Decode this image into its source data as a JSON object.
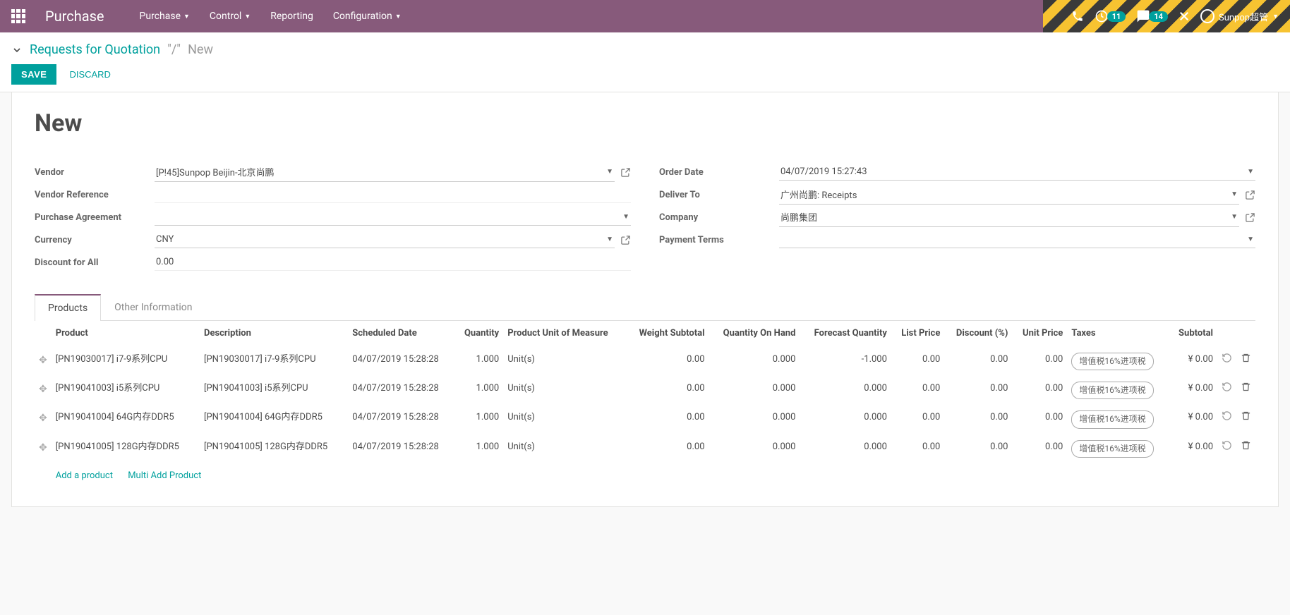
{
  "nav": {
    "brand": "Purchase",
    "items": [
      "Purchase",
      "Control",
      "Reporting",
      "Configuration"
    ],
    "badge1": "11",
    "badge2": "14",
    "user": "Sunpop超管"
  },
  "breadcrumb": {
    "parent": "Requests for Quotation",
    "sep": "\"/\"",
    "active": "New"
  },
  "buttons": {
    "save": "SAVE",
    "discard": "DISCARD"
  },
  "form": {
    "title": "New",
    "labels": {
      "vendor": "Vendor",
      "vendor_ref": "Vendor Reference",
      "purchase_agreement": "Purchase Agreement",
      "currency": "Currency",
      "discount_all": "Discount for All",
      "order_date": "Order Date",
      "deliver_to": "Deliver To",
      "company": "Company",
      "payment_terms": "Payment Terms"
    },
    "values": {
      "vendor": "[P!45]Sunpop Beijin-北京尚鹏",
      "vendor_ref": "",
      "purchase_agreement": "",
      "currency": "CNY",
      "discount_all": "0.00",
      "order_date": "04/07/2019 15:27:43",
      "deliver_to": "广州尚鹏: Receipts",
      "company": "尚鹏集团",
      "payment_terms": ""
    }
  },
  "tabs": {
    "products": "Products",
    "other": "Other Information"
  },
  "table": {
    "headers": {
      "product": "Product",
      "description": "Description",
      "scheduled_date": "Scheduled Date",
      "quantity": "Quantity",
      "uom": "Product Unit of Measure",
      "weight_subtotal": "Weight Subtotal",
      "qty_on_hand": "Quantity On Hand",
      "forecast_qty": "Forecast Quantity",
      "list_price": "List Price",
      "discount": "Discount (%)",
      "unit_price": "Unit Price",
      "taxes": "Taxes",
      "subtotal": "Subtotal"
    },
    "rows": [
      {
        "product": "[PN19030017] i7-9系列CPU",
        "description": "[PN19030017] i7-9系列CPU",
        "date": "04/07/2019 15:28:28",
        "qty": "1.000",
        "uom": "Unit(s)",
        "ws": "0.00",
        "qoh": "0.000",
        "fq": "-1.000",
        "lp": "0.00",
        "disc": "0.00",
        "up": "0.00",
        "tax": "增值税16%进项税",
        "sub": "¥ 0.00"
      },
      {
        "product": "[PN19041003] i5系列CPU",
        "description": "[PN19041003] i5系列CPU",
        "date": "04/07/2019 15:28:28",
        "qty": "1.000",
        "uom": "Unit(s)",
        "ws": "0.00",
        "qoh": "0.000",
        "fq": "0.000",
        "lp": "0.00",
        "disc": "0.00",
        "up": "0.00",
        "tax": "增值税16%进项税",
        "sub": "¥ 0.00"
      },
      {
        "product": "[PN19041004] 64G内存DDR5",
        "description": "[PN19041004] 64G内存DDR5",
        "date": "04/07/2019 15:28:28",
        "qty": "1.000",
        "uom": "Unit(s)",
        "ws": "0.00",
        "qoh": "0.000",
        "fq": "0.000",
        "lp": "0.00",
        "disc": "0.00",
        "up": "0.00",
        "tax": "增值税16%进项税",
        "sub": "¥ 0.00"
      },
      {
        "product": "[PN19041005] 128G内存DDR5",
        "description": "[PN19041005] 128G内存DDR5",
        "date": "04/07/2019 15:28:28",
        "qty": "1.000",
        "uom": "Unit(s)",
        "ws": "0.00",
        "qoh": "0.000",
        "fq": "0.000",
        "lp": "0.00",
        "disc": "0.00",
        "up": "0.00",
        "tax": "增值税16%进项税",
        "sub": "¥ 0.00"
      }
    ],
    "footer": {
      "add_product": "Add a product",
      "multi_add": "Multi Add Product"
    }
  }
}
